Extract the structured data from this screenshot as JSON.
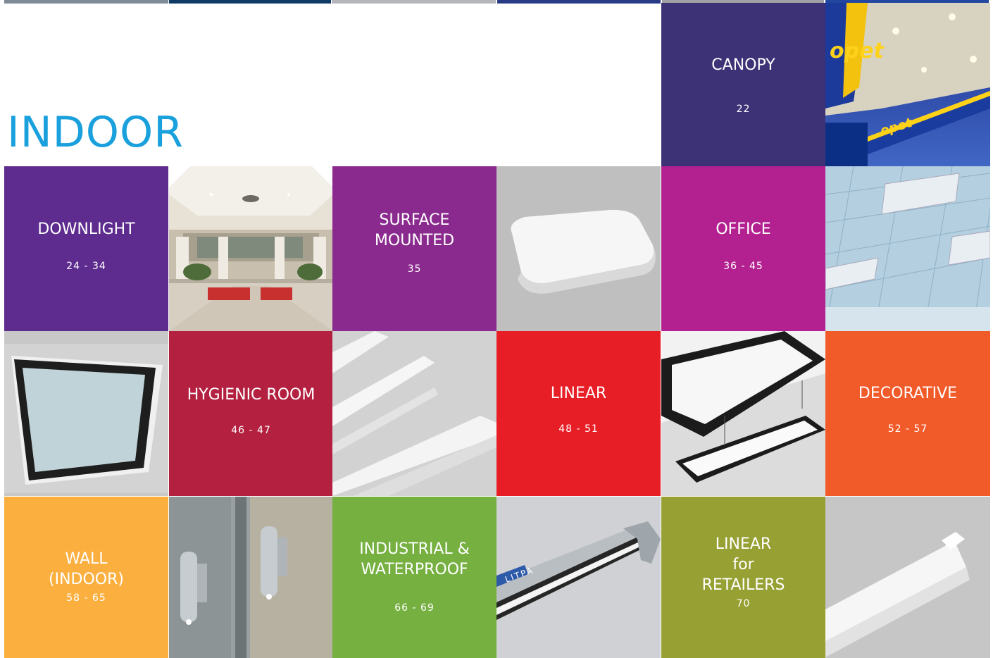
{
  "section_title": "INDOOR",
  "categories": {
    "canopy": {
      "name": "CANOPY",
      "pages": "22"
    },
    "downlight": {
      "name": "DOWNLIGHT",
      "pages": "24 - 34"
    },
    "surface": {
      "name_line1": "SURFACE",
      "name_line2": "MOUNTED",
      "pages": "35"
    },
    "office": {
      "name": "OFFICE",
      "pages": "36 - 45"
    },
    "hygienic": {
      "name": "HYGIENIC ROOM",
      "pages": "46 - 47"
    },
    "linear": {
      "name": "LINEAR",
      "pages": "48 - 51"
    },
    "decorative": {
      "name": "DECORATIVE",
      "pages": "52 - 57"
    },
    "wall": {
      "name_line1": "WALL",
      "name_line2": "(INDOOR)",
      "pages": "58 - 65"
    },
    "industrial": {
      "name_line1": "INDUSTRIAL &",
      "name_line2": "WATERPROOF",
      "pages": "66 - 69"
    },
    "retail": {
      "name_line1": "LINEAR",
      "name_line2": "for",
      "name_line3": "RETAILERS",
      "pages": "70"
    }
  },
  "photo_texts": {
    "station_brand": "opet",
    "station_brand_2": "opet",
    "fixture_brand": "LITPA"
  },
  "colors": {
    "title": "#1aa0dc",
    "canopy": "#3e3277",
    "downlight": "#5e2b8e",
    "surface": "#8a2a8e",
    "office": "#b32190",
    "hygienic": "#b32040",
    "linear": "#e81e26",
    "decorative": "#f15a29",
    "wall": "#fbaf3f",
    "industrial": "#76b041",
    "retail": "#97a033"
  }
}
